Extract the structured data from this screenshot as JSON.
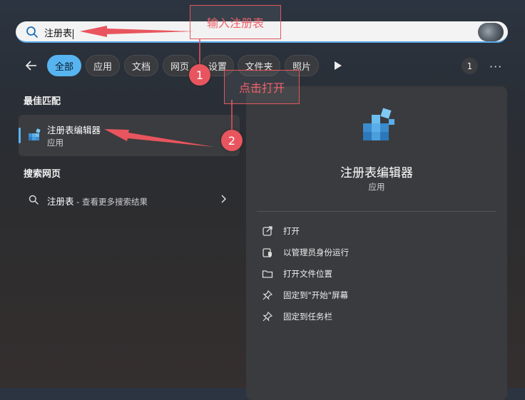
{
  "search": {
    "query": "注册表"
  },
  "filters": [
    {
      "label": "全部",
      "active": true
    },
    {
      "label": "应用",
      "active": false
    },
    {
      "label": "文档",
      "active": false
    },
    {
      "label": "网页",
      "active": false
    },
    {
      "label": "设置",
      "active": false
    },
    {
      "label": "文件夹",
      "active": false
    },
    {
      "label": "照片",
      "active": false
    }
  ],
  "badge_count": "1",
  "more_label": "···",
  "best_match": {
    "section_title": "最佳匹配",
    "name": "注册表编辑器",
    "type": "应用"
  },
  "web_search": {
    "section_title": "搜索网页",
    "query": "注册表",
    "suffix": " - 查看更多搜索结果"
  },
  "detail": {
    "name": "注册表编辑器",
    "type": "应用",
    "actions": [
      {
        "label": "打开",
        "icon": "open-external-icon"
      },
      {
        "label": "以管理员身份运行",
        "icon": "shield-icon"
      },
      {
        "label": "打开文件位置",
        "icon": "folder-icon"
      },
      {
        "label": "固定到\"开始\"屏幕",
        "icon": "pin-icon"
      },
      {
        "label": "固定到任务栏",
        "icon": "pin-icon"
      }
    ]
  },
  "annotations": {
    "callout1": "输入注册表",
    "callout2": "点击打开",
    "step1": "1",
    "step2": "2",
    "color": "#e8555e"
  },
  "colors": {
    "accent": "#57b4f0"
  }
}
